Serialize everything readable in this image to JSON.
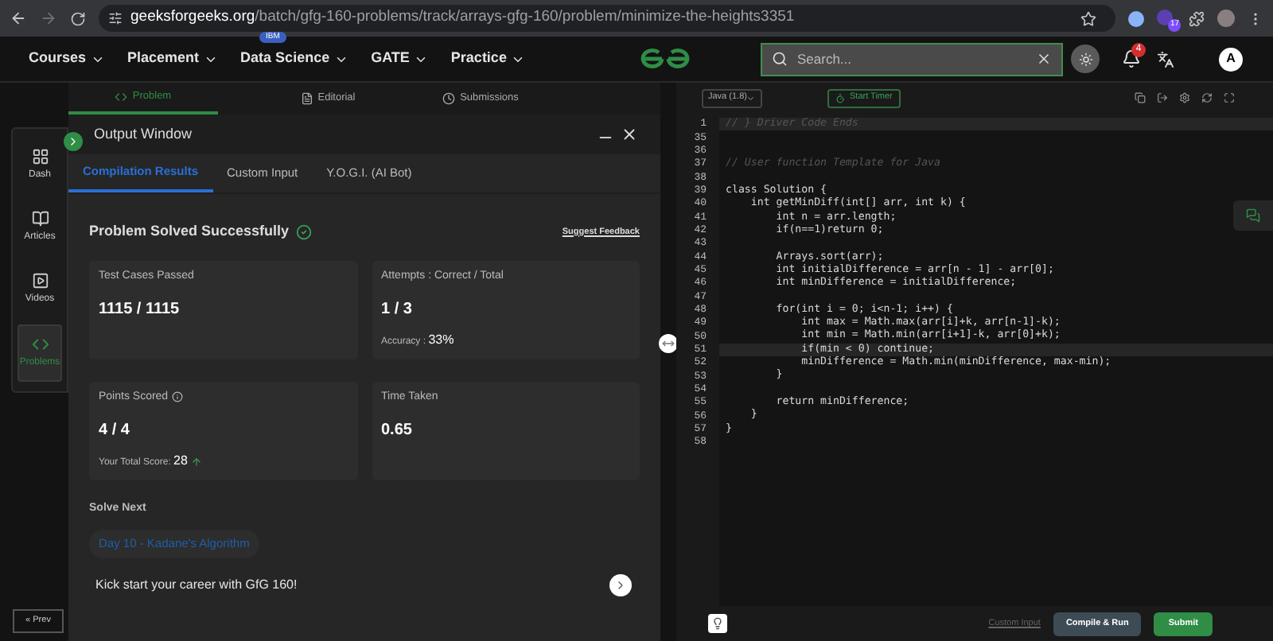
{
  "browser": {
    "url_host": "geeksforgeeks.org",
    "url_path": "/batch/gfg-160-problems/track/arrays-gfg-160/problem/minimize-the-heights3351",
    "extension_badge": "17"
  },
  "nav": {
    "items": [
      {
        "label": "Courses"
      },
      {
        "label": "Placement"
      },
      {
        "label": "Data Science",
        "badge": "IBM"
      },
      {
        "label": "GATE"
      },
      {
        "label": "Practice"
      }
    ],
    "search": {
      "placeholder": "Search..."
    },
    "notifications": "4",
    "avatar": "A"
  },
  "sidebar": {
    "items": [
      {
        "label": "Dash",
        "kind": "grid",
        "selected": false
      },
      {
        "label": "Articles",
        "kind": "book",
        "selected": false
      },
      {
        "label": "Videos",
        "kind": "video",
        "selected": false
      },
      {
        "label": "Problems",
        "kind": "code",
        "selected": true
      }
    ],
    "prev": "« Prev"
  },
  "problem_tabs": [
    {
      "label": "Problem",
      "kind": "code",
      "selected": true
    },
    {
      "label": "Editorial",
      "kind": "doc",
      "selected": false
    },
    {
      "label": "Submissions",
      "kind": "clock",
      "selected": false
    }
  ],
  "output_window": {
    "title": "Output Window",
    "tabs": [
      {
        "label": "Compilation Results",
        "selected": true
      },
      {
        "label": "Custom Input",
        "selected": false
      },
      {
        "label": "Y.O.G.I. (AI Bot)",
        "selected": false
      }
    ],
    "status": "Problem Solved Successfully",
    "feedback": "Suggest Feedback",
    "cards": [
      {
        "label": "Test Cases Passed",
        "value": "1115 / 1115",
        "trend_up": false,
        "info": false
      },
      {
        "label": "Attempts : Correct / Total",
        "value": "1 / 3",
        "note_label": "Accuracy : ",
        "note_value": "33%",
        "trend_up": false,
        "info": false
      },
      {
        "label": "Points Scored",
        "value": "4 / 4",
        "note_label": "Your Total Score: ",
        "note_value": "28",
        "trend_up": true,
        "info": true
      },
      {
        "label": "Time Taken",
        "value": "0.65",
        "trend_up": false,
        "info": false
      }
    ],
    "solve_next": {
      "title": "Solve Next",
      "chip": "Day 10 - Kadane's Algorithm",
      "promo": "Kick start your career with GfG 160!"
    }
  },
  "editor": {
    "language": "Java (1.8)",
    "timer": "Start Timer",
    "lines": [
      {
        "number": "1",
        "code": "// } Driver Code Ends",
        "kind": "comment",
        "highlighted": true
      },
      {
        "number": "35",
        "highlighted": false
      },
      {
        "number": "36",
        "highlighted": false
      },
      {
        "number": "37",
        "code": "// User function Template for Java",
        "kind": "comment",
        "highlighted": false
      },
      {
        "number": "38",
        "highlighted": false
      },
      {
        "number": "39",
        "code": "class Solution {",
        "kind": "code",
        "highlighted": false
      },
      {
        "number": "40",
        "code": "    int getMinDiff(int[] arr, int k) {",
        "kind": "code",
        "highlighted": false
      },
      {
        "number": "41",
        "code": "        int n = arr.length;",
        "kind": "code",
        "highlighted": false
      },
      {
        "number": "42",
        "code": "        if(n==1)return 0;",
        "kind": "code",
        "highlighted": false
      },
      {
        "number": "43",
        "highlighted": false
      },
      {
        "number": "44",
        "code": "        Arrays.sort(arr);",
        "kind": "code",
        "highlighted": false
      },
      {
        "number": "45",
        "code": "        int initialDifference = arr[n - 1] - arr[0];",
        "kind": "code",
        "highlighted": false
      },
      {
        "number": "46",
        "code": "        int minDifference = initialDifference;",
        "kind": "code",
        "highlighted": false
      },
      {
        "number": "47",
        "highlighted": false
      },
      {
        "number": "48",
        "code": "        for(int i = 0; i<n-1; i++) {",
        "kind": "code",
        "highlighted": false
      },
      {
        "number": "49",
        "code": "            int max = Math.max(arr[i]+k, arr[n-1]-k);",
        "kind": "code",
        "highlighted": false
      },
      {
        "number": "50",
        "code": "            int min = Math.min(arr[i+1]-k, arr[0]+k);",
        "kind": "code",
        "highlighted": false
      },
      {
        "number": "51",
        "code": "            if(min < 0) continue;",
        "kind": "code",
        "highlighted": true
      },
      {
        "number": "52",
        "code": "            minDifference = Math.min(minDifference, max-min);",
        "kind": "code",
        "highlighted": false
      },
      {
        "number": "53",
        "code": "        }",
        "kind": "code",
        "highlighted": false
      },
      {
        "number": "54",
        "highlighted": false
      },
      {
        "number": "55",
        "code": "        return minDifference;",
        "kind": "code",
        "highlighted": false
      },
      {
        "number": "56",
        "code": "    }",
        "kind": "code",
        "highlighted": false
      },
      {
        "number": "57",
        "code": "}",
        "kind": "code",
        "highlighted": false
      },
      {
        "number": "58",
        "highlighted": false
      }
    ],
    "custom_input": "Custom Input",
    "compile": "Compile & Run",
    "submit": "Submit"
  }
}
